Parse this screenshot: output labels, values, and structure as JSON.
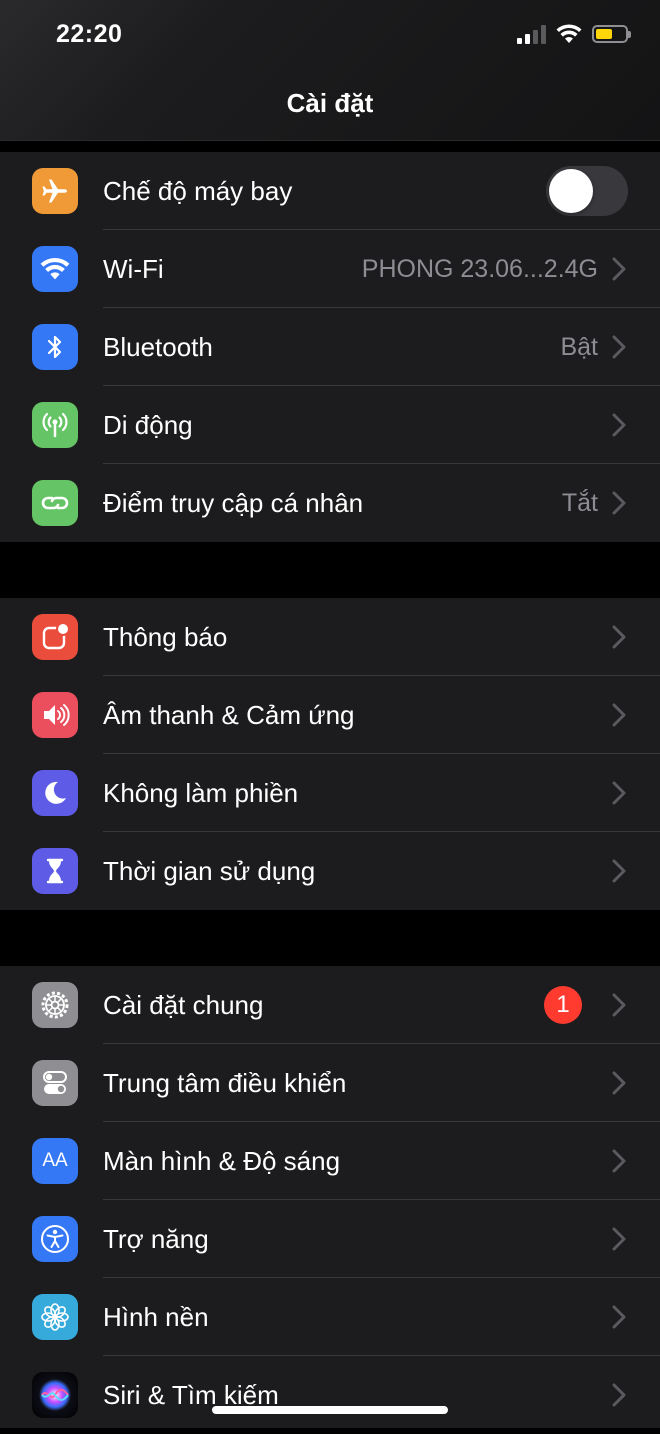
{
  "status_bar": {
    "time": "22:20"
  },
  "title": "Cài đặt",
  "groups": [
    {
      "items": [
        {
          "label": "Chế độ máy bay",
          "icon": "airplane-icon",
          "color": "#f09a37",
          "toggle": false
        },
        {
          "label": "Wi-Fi",
          "value": "PHONG 23.06...2.4G",
          "icon": "wifi-icon",
          "color": "#3478f6"
        },
        {
          "label": "Bluetooth",
          "value": "Bật",
          "icon": "bluetooth-icon",
          "color": "#3478f6"
        },
        {
          "label": "Di động",
          "icon": "cellular-icon",
          "color": "#65c466"
        },
        {
          "label": "Điểm truy cập cá nhân",
          "value": "Tắt",
          "icon": "hotspot-icon",
          "color": "#65c466"
        }
      ]
    },
    {
      "items": [
        {
          "label": "Thông báo",
          "icon": "notifications-icon",
          "color": "#eb4d3d"
        },
        {
          "label": "Âm thanh & Cảm ứng",
          "icon": "speaker-icon",
          "color": "#eb4e5c"
        },
        {
          "label": "Không làm phiền",
          "icon": "moon-icon",
          "color": "#5e5ce6"
        },
        {
          "label": "Thời gian sử dụng",
          "icon": "hourglass-icon",
          "color": "#5e5ce6"
        }
      ]
    },
    {
      "items": [
        {
          "label": "Cài đặt chung",
          "badge": "1",
          "icon": "gear-icon",
          "color": "#8e8e93"
        },
        {
          "label": "Trung tâm điều khiển",
          "icon": "switches-icon",
          "color": "#8e8e93"
        },
        {
          "label": "Màn hình & Độ sáng",
          "icon": "text-size-icon",
          "color": "#3478f6",
          "icon_text": "AA"
        },
        {
          "label": "Trợ năng",
          "icon": "accessibility-icon",
          "color": "#3478f6"
        },
        {
          "label": "Hình nền",
          "icon": "flower-icon",
          "color": "#37aadc"
        },
        {
          "label": "Siri & Tìm kiếm",
          "icon": "siri-icon",
          "color": "#1a1a2e"
        }
      ]
    }
  ]
}
